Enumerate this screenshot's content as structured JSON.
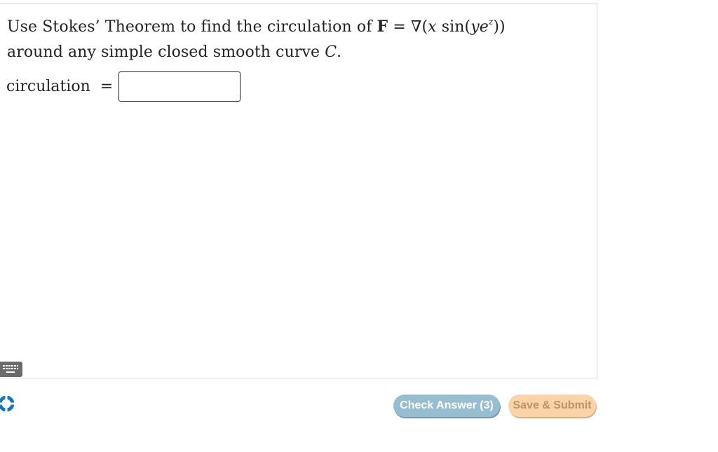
{
  "question": {
    "line1_prefix": "Use Stokes’ Theorem to find the circulation of ",
    "vector": "F",
    "equals": " = ∇(",
    "x": "x",
    "sin": " sin(",
    "y": "y",
    "e": "e",
    "z": "z",
    "close": "))",
    "line2_prefix": "around any simple closed smooth curve ",
    "curve": "C",
    "period": "."
  },
  "answer": {
    "label": "circulation  =",
    "value": ""
  },
  "buttons": {
    "check": "Check Answer (3)",
    "save": "Save & Submit"
  },
  "icons": {
    "keyboard": "keyboard-icon",
    "help": "lifebuoy-icon"
  },
  "colors": {
    "check_button": "#96bdd0",
    "save_button": "#fbd3a8",
    "keyboard": "#6b6b6b",
    "help": "#1b75bc"
  }
}
